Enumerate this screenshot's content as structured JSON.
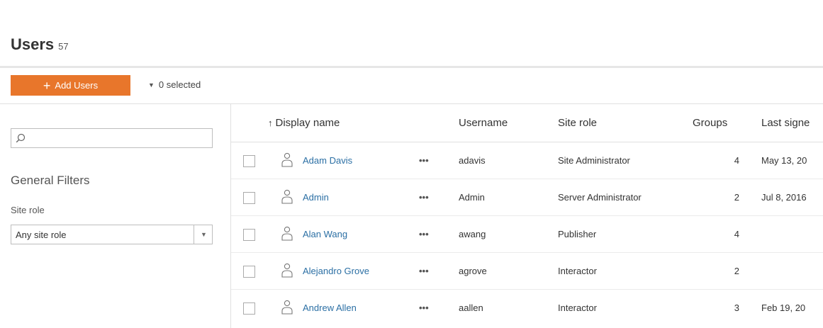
{
  "header": {
    "title": "Users",
    "count": "57"
  },
  "toolbar": {
    "add_users_label": "Add Users",
    "selected_label": "0 selected"
  },
  "sidebar": {
    "search_placeholder": "",
    "filters_heading": "General Filters",
    "site_role_label": "Site role",
    "site_role_selected": "Any site role"
  },
  "table": {
    "columns": [
      "Display name",
      "Username",
      "Site role",
      "Groups",
      "Last signe"
    ],
    "rows": [
      {
        "display_name": "Adam Davis",
        "username": "adavis",
        "site_role": "Site Administrator",
        "groups": "4",
        "last_signed_in": "May 13, 20"
      },
      {
        "display_name": "Admin",
        "username": "Admin",
        "site_role": "Server Administrator",
        "groups": "2",
        "last_signed_in": "Jul 8, 2016"
      },
      {
        "display_name": "Alan Wang",
        "username": "awang",
        "site_role": "Publisher",
        "groups": "4",
        "last_signed_in": ""
      },
      {
        "display_name": "Alejandro Grove",
        "username": "agrove",
        "site_role": "Interactor",
        "groups": "2",
        "last_signed_in": ""
      },
      {
        "display_name": "Andrew Allen",
        "username": "aallen",
        "site_role": "Interactor",
        "groups": "3",
        "last_signed_in": "Feb 19, 20"
      }
    ],
    "more_label": "•••"
  },
  "colors": {
    "accent": "#e8762b",
    "link": "#2b6fa4"
  },
  "icons": {
    "search": "search-icon",
    "user": "user-icon",
    "more": "more-icon",
    "sort": "sort-ascending-icon"
  }
}
